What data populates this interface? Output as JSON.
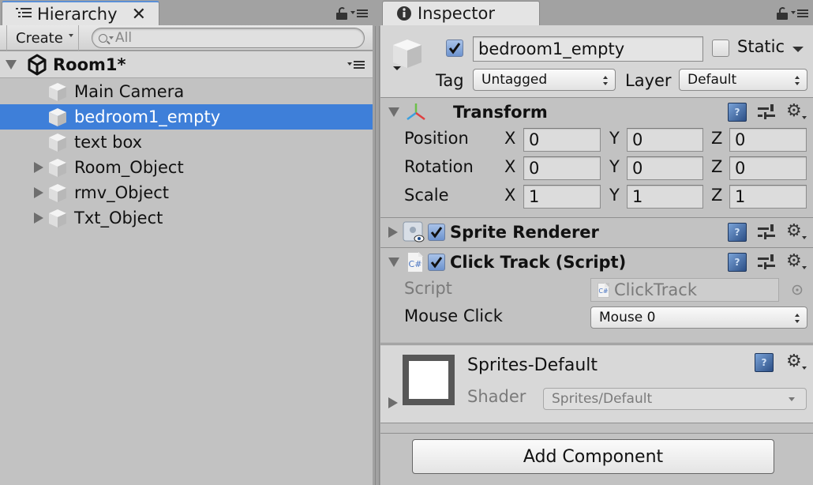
{
  "hierarchy": {
    "tab_label": "Hierarchy",
    "close_glyph": "✕",
    "toolbar": {
      "create_label": "Create",
      "search_placeholder": "All"
    },
    "scene": {
      "name": "Room1*",
      "icon": "unity-logo-icon"
    },
    "items": [
      {
        "label": "Main Camera",
        "expandable": false,
        "selected": false,
        "icon": "gameobject-cube-icon"
      },
      {
        "label": "bedroom1_empty",
        "expandable": false,
        "selected": true,
        "icon": "gameobject-cube-icon"
      },
      {
        "label": "text box",
        "expandable": false,
        "selected": false,
        "icon": "gameobject-cube-icon"
      },
      {
        "label": "Room_Object",
        "expandable": true,
        "selected": false,
        "icon": "gameobject-cube-icon"
      },
      {
        "label": "rmv_Object",
        "expandable": true,
        "selected": false,
        "icon": "gameobject-cube-icon"
      },
      {
        "label": "Txt_Object",
        "expandable": true,
        "selected": false,
        "icon": "gameobject-cube-icon"
      }
    ],
    "selection_color": "#3e7fd9"
  },
  "inspector": {
    "tab_label": "Inspector",
    "gameobject": {
      "active": true,
      "name": "bedroom1_empty",
      "static_label": "Static",
      "static": false,
      "tag_label": "Tag",
      "tag_value": "Untagged",
      "layer_label": "Layer",
      "layer_value": "Default"
    },
    "transform": {
      "title": "Transform",
      "rows": [
        {
          "label": "Position",
          "x": "0",
          "y": "0",
          "z": "0"
        },
        {
          "label": "Rotation",
          "x": "0",
          "y": "0",
          "z": "0"
        },
        {
          "label": "Scale",
          "x": "1",
          "y": "1",
          "z": "1"
        }
      ],
      "axis_labels": {
        "x": "X",
        "y": "Y",
        "z": "Z"
      }
    },
    "sprite_renderer": {
      "title": "Sprite Renderer",
      "enabled": true
    },
    "click_track": {
      "title": "Click Track (Script)",
      "enabled": true,
      "script_label": "Script",
      "script_value": "ClickTrack",
      "script_icon_text": "C#",
      "mouse_click_label": "Mouse Click",
      "mouse_click_value": "Mouse 0"
    },
    "material": {
      "name": "Sprites-Default",
      "shader_label": "Shader",
      "shader_value": "Sprites/Default"
    },
    "add_component_label": "Add Component",
    "help_glyph": "?",
    "gear_glyph": "⚙"
  }
}
